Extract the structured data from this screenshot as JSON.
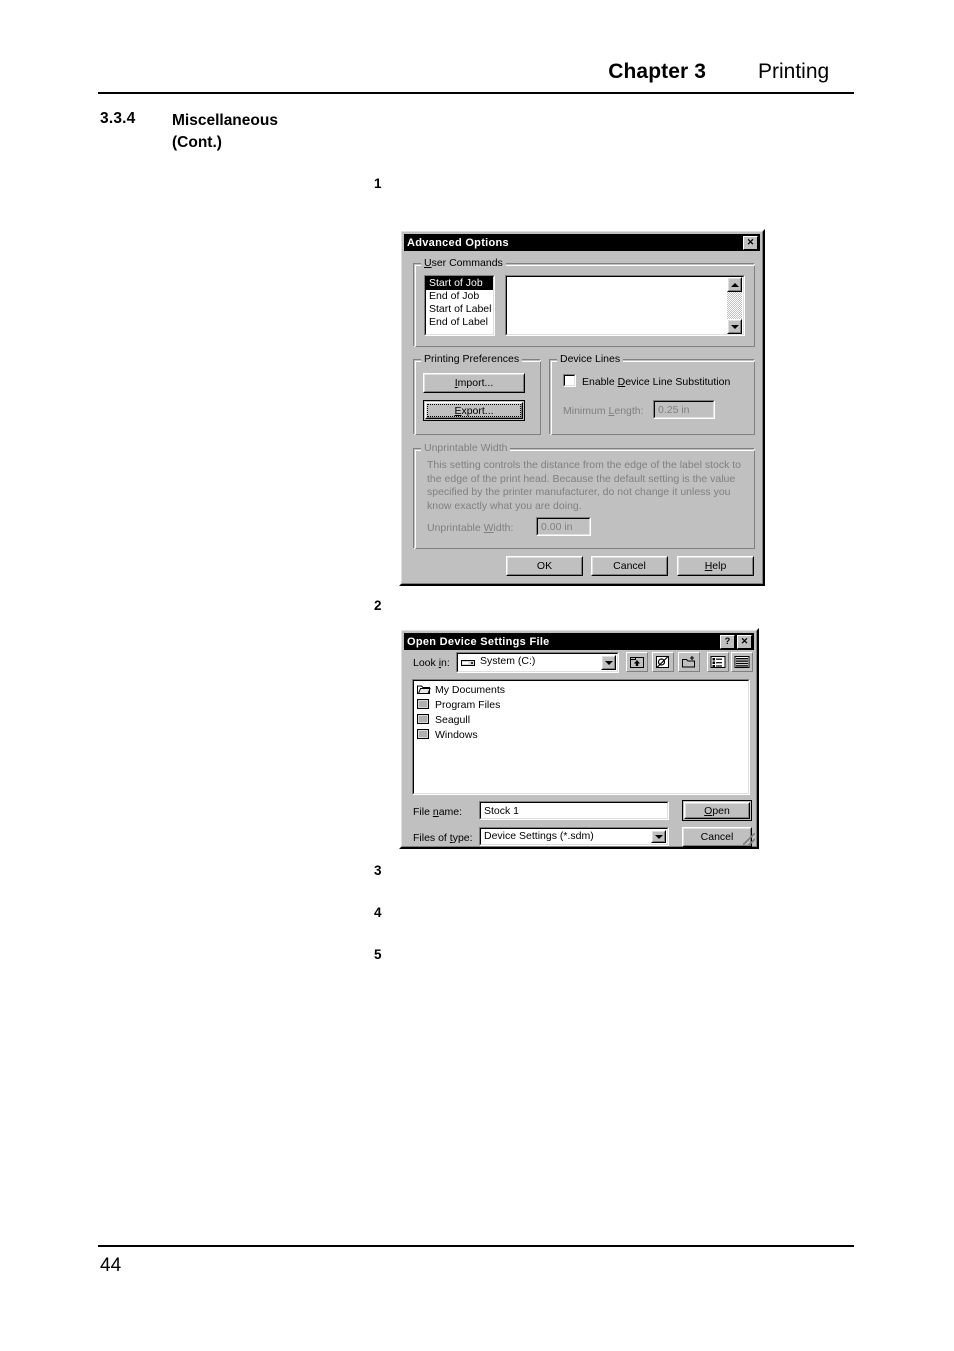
{
  "header": {
    "chapter": "Chapter 3",
    "section": "Printing"
  },
  "heading": {
    "number": "3.3.4",
    "title_line1": "Miscellaneous",
    "title_line2": "(Cont.)"
  },
  "steps": {
    "s1": "1",
    "s2": "2",
    "s3": "3",
    "s4": "4",
    "s5": "5"
  },
  "footer": {
    "page_number": "44"
  },
  "advanced_options_dialog": {
    "title": "Advanced Options",
    "close_button": "✕",
    "user_commands": {
      "group_label": "User Commands",
      "items": [
        "Start of Job",
        "End of Job",
        "Start of Label",
        "End of Label"
      ],
      "selected_index": 0,
      "command_text": ""
    },
    "printing_preferences": {
      "group_label": "Printing Preferences",
      "import_button": "Import...",
      "export_button": "Export..."
    },
    "device_lines": {
      "group_label": "Device Lines",
      "enable_checkbox_label": "Enable Device Line Substitution",
      "enable_checked": false,
      "minimum_length_label": "Minimum Length:",
      "minimum_length_value": "0.25 in",
      "disabled": true
    },
    "unprintable_width": {
      "group_label": "Unprintable Width",
      "description": "This setting controls the distance from the edge of the label stock to the edge of the print head.  Because the default setting is the value specified by the printer manufacturer, do not change it unless you know exactly what you are doing.",
      "field_label": "Unprintable Width:",
      "field_value": "0.00 in",
      "disabled": true
    },
    "buttons": {
      "ok": "OK",
      "cancel": "Cancel",
      "help": "Help"
    }
  },
  "open_file_dialog": {
    "title": "Open Device Settings File",
    "help_button": "?",
    "close_button": "✕",
    "look_in_label": "Look in:",
    "look_in_value": "System (C:)",
    "toolbar_icons": [
      "up-one-level-icon",
      "look-in-favorites-icon",
      "create-new-folder-icon",
      "list-view-icon",
      "details-view-icon"
    ],
    "files": [
      {
        "name": "My Documents",
        "icon": "special-folder-icon"
      },
      {
        "name": "Program Files",
        "icon": "folder-icon"
      },
      {
        "name": "Seagull",
        "icon": "folder-icon"
      },
      {
        "name": "Windows",
        "icon": "folder-icon"
      }
    ],
    "file_name_label": "File name:",
    "file_name_value": "Stock 1",
    "files_of_type_label": "Files of type:",
    "files_of_type_value": "Device Settings (*.sdm)",
    "open_button": "Open",
    "cancel_button": "Cancel"
  },
  "colors": {
    "window_face": "#c0c0c0",
    "titlebar": "#000000",
    "titlebar_text": "#ffffff",
    "disabled_text": "#808080",
    "field_bg": "#ffffff",
    "selection_bg": "#000000"
  }
}
